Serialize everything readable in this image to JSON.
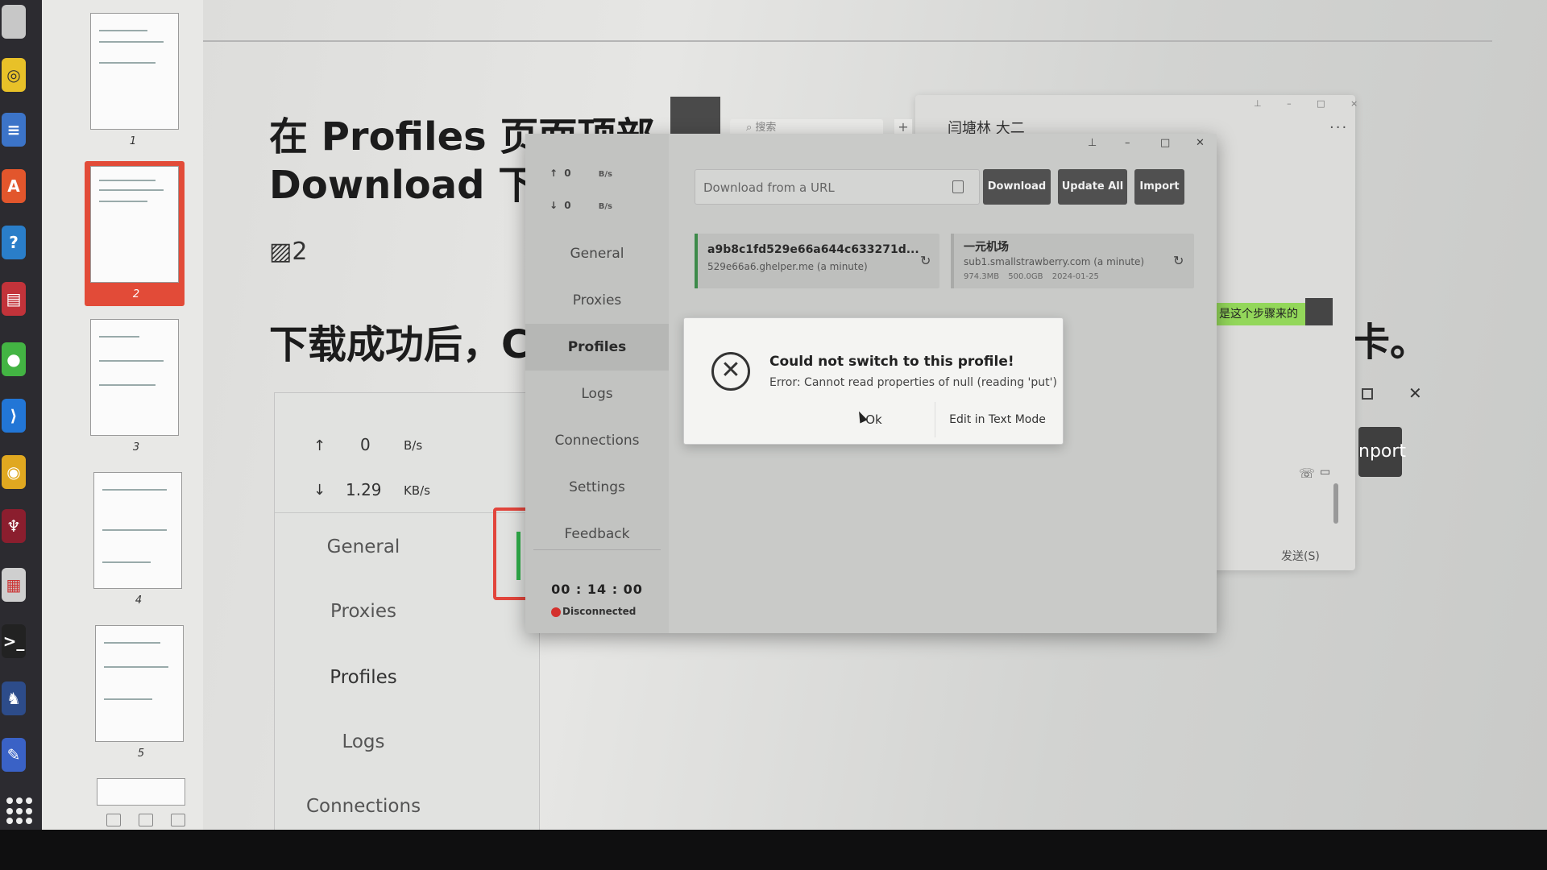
{
  "doc": {
    "heading": "在 Profiles 页面顶部\nDownload 下载",
    "broken_image_label": "2",
    "line2": "下载成功后，C",
    "tail": "卡。",
    "embed": {
      "up_value": "0",
      "up_unit": "B/s",
      "down_value": "1.29",
      "down_unit": "KB/s",
      "nav": [
        "General",
        "Proxies",
        "Profiles",
        "Logs",
        "Connections"
      ]
    }
  },
  "thumbnails": [
    {
      "num": "1"
    },
    {
      "num": "2"
    },
    {
      "num": "3"
    },
    {
      "num": "4"
    },
    {
      "num": "5"
    }
  ],
  "chat": {
    "search_placeholder": "搜索",
    "plus": "+",
    "title": "闫塘林 大二",
    "more": "···",
    "bubble": "是这个步骤来的",
    "send_label": "发送(S)",
    "import_partial": "nport"
  },
  "clash": {
    "speed": {
      "up_value": "0",
      "up_unit": "B/s",
      "down_value": "0",
      "down_unit": "B/s"
    },
    "nav": [
      {
        "label": "General"
      },
      {
        "label": "Proxies"
      },
      {
        "label": "Profiles"
      },
      {
        "label": "Logs"
      },
      {
        "label": "Connections"
      },
      {
        "label": "Settings"
      },
      {
        "label": "Feedback"
      }
    ],
    "timer": "00 : 14 : 00",
    "status": "Disconnected",
    "url_placeholder": "Download from a URL",
    "buttons": {
      "download": "Download",
      "update_all": "Update All",
      "import": "Import"
    },
    "profiles": [
      {
        "name": "a9b8c1fd529e66a644c633271d...",
        "sub": "529e66a6.ghelper.me (a minute)",
        "meta": ""
      },
      {
        "name": "一元机场",
        "sub": "sub1.smallstrawberry.com (a minute)",
        "meta": "974.3MB 500.0GB 2024-01-25"
      }
    ]
  },
  "modal": {
    "title": "Could not switch to this profile!",
    "message": "Error: Cannot read properties of null (reading 'put')",
    "ok_label": "Ok",
    "edit_label": "Edit in Text Mode"
  },
  "colors": {
    "accent_active_bar": "#3d8a4a",
    "status_disconnected": "#d4302c",
    "button_bg": "#505050"
  }
}
